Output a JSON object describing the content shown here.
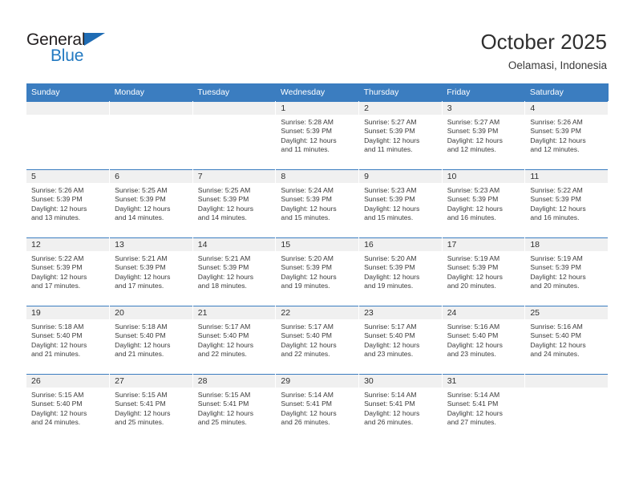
{
  "brand": {
    "name_part1": "General",
    "name_part2": "Blue",
    "triangle_color": "#1f6cb4",
    "blue_text_color": "#2279c1"
  },
  "header": {
    "month_title": "October 2025",
    "location": "Oelamasi, Indonesia"
  },
  "theme": {
    "header_blue": "#3b7dc0",
    "daynum_band": "#f0f0f0",
    "cell_bg": "#ffffff"
  },
  "calendar": {
    "weekday_headers": [
      "Sunday",
      "Monday",
      "Tuesday",
      "Wednesday",
      "Thursday",
      "Friday",
      "Saturday"
    ],
    "weeks": [
      [
        {
          "day": "",
          "lines": []
        },
        {
          "day": "",
          "lines": []
        },
        {
          "day": "",
          "lines": []
        },
        {
          "day": "1",
          "lines": [
            "Sunrise: 5:28 AM",
            "Sunset: 5:39 PM",
            "Daylight: 12 hours",
            "and 11 minutes."
          ]
        },
        {
          "day": "2",
          "lines": [
            "Sunrise: 5:27 AM",
            "Sunset: 5:39 PM",
            "Daylight: 12 hours",
            "and 11 minutes."
          ]
        },
        {
          "day": "3",
          "lines": [
            "Sunrise: 5:27 AM",
            "Sunset: 5:39 PM",
            "Daylight: 12 hours",
            "and 12 minutes."
          ]
        },
        {
          "day": "4",
          "lines": [
            "Sunrise: 5:26 AM",
            "Sunset: 5:39 PM",
            "Daylight: 12 hours",
            "and 12 minutes."
          ]
        }
      ],
      [
        {
          "day": "5",
          "lines": [
            "Sunrise: 5:26 AM",
            "Sunset: 5:39 PM",
            "Daylight: 12 hours",
            "and 13 minutes."
          ]
        },
        {
          "day": "6",
          "lines": [
            "Sunrise: 5:25 AM",
            "Sunset: 5:39 PM",
            "Daylight: 12 hours",
            "and 14 minutes."
          ]
        },
        {
          "day": "7",
          "lines": [
            "Sunrise: 5:25 AM",
            "Sunset: 5:39 PM",
            "Daylight: 12 hours",
            "and 14 minutes."
          ]
        },
        {
          "day": "8",
          "lines": [
            "Sunrise: 5:24 AM",
            "Sunset: 5:39 PM",
            "Daylight: 12 hours",
            "and 15 minutes."
          ]
        },
        {
          "day": "9",
          "lines": [
            "Sunrise: 5:23 AM",
            "Sunset: 5:39 PM",
            "Daylight: 12 hours",
            "and 15 minutes."
          ]
        },
        {
          "day": "10",
          "lines": [
            "Sunrise: 5:23 AM",
            "Sunset: 5:39 PM",
            "Daylight: 12 hours",
            "and 16 minutes."
          ]
        },
        {
          "day": "11",
          "lines": [
            "Sunrise: 5:22 AM",
            "Sunset: 5:39 PM",
            "Daylight: 12 hours",
            "and 16 minutes."
          ]
        }
      ],
      [
        {
          "day": "12",
          "lines": [
            "Sunrise: 5:22 AM",
            "Sunset: 5:39 PM",
            "Daylight: 12 hours",
            "and 17 minutes."
          ]
        },
        {
          "day": "13",
          "lines": [
            "Sunrise: 5:21 AM",
            "Sunset: 5:39 PM",
            "Daylight: 12 hours",
            "and 17 minutes."
          ]
        },
        {
          "day": "14",
          "lines": [
            "Sunrise: 5:21 AM",
            "Sunset: 5:39 PM",
            "Daylight: 12 hours",
            "and 18 minutes."
          ]
        },
        {
          "day": "15",
          "lines": [
            "Sunrise: 5:20 AM",
            "Sunset: 5:39 PM",
            "Daylight: 12 hours",
            "and 19 minutes."
          ]
        },
        {
          "day": "16",
          "lines": [
            "Sunrise: 5:20 AM",
            "Sunset: 5:39 PM",
            "Daylight: 12 hours",
            "and 19 minutes."
          ]
        },
        {
          "day": "17",
          "lines": [
            "Sunrise: 5:19 AM",
            "Sunset: 5:39 PM",
            "Daylight: 12 hours",
            "and 20 minutes."
          ]
        },
        {
          "day": "18",
          "lines": [
            "Sunrise: 5:19 AM",
            "Sunset: 5:39 PM",
            "Daylight: 12 hours",
            "and 20 minutes."
          ]
        }
      ],
      [
        {
          "day": "19",
          "lines": [
            "Sunrise: 5:18 AM",
            "Sunset: 5:40 PM",
            "Daylight: 12 hours",
            "and 21 minutes."
          ]
        },
        {
          "day": "20",
          "lines": [
            "Sunrise: 5:18 AM",
            "Sunset: 5:40 PM",
            "Daylight: 12 hours",
            "and 21 minutes."
          ]
        },
        {
          "day": "21",
          "lines": [
            "Sunrise: 5:17 AM",
            "Sunset: 5:40 PM",
            "Daylight: 12 hours",
            "and 22 minutes."
          ]
        },
        {
          "day": "22",
          "lines": [
            "Sunrise: 5:17 AM",
            "Sunset: 5:40 PM",
            "Daylight: 12 hours",
            "and 22 minutes."
          ]
        },
        {
          "day": "23",
          "lines": [
            "Sunrise: 5:17 AM",
            "Sunset: 5:40 PM",
            "Daylight: 12 hours",
            "and 23 minutes."
          ]
        },
        {
          "day": "24",
          "lines": [
            "Sunrise: 5:16 AM",
            "Sunset: 5:40 PM",
            "Daylight: 12 hours",
            "and 23 minutes."
          ]
        },
        {
          "day": "25",
          "lines": [
            "Sunrise: 5:16 AM",
            "Sunset: 5:40 PM",
            "Daylight: 12 hours",
            "and 24 minutes."
          ]
        }
      ],
      [
        {
          "day": "26",
          "lines": [
            "Sunrise: 5:15 AM",
            "Sunset: 5:40 PM",
            "Daylight: 12 hours",
            "and 24 minutes."
          ]
        },
        {
          "day": "27",
          "lines": [
            "Sunrise: 5:15 AM",
            "Sunset: 5:41 PM",
            "Daylight: 12 hours",
            "and 25 minutes."
          ]
        },
        {
          "day": "28",
          "lines": [
            "Sunrise: 5:15 AM",
            "Sunset: 5:41 PM",
            "Daylight: 12 hours",
            "and 25 minutes."
          ]
        },
        {
          "day": "29",
          "lines": [
            "Sunrise: 5:14 AM",
            "Sunset: 5:41 PM",
            "Daylight: 12 hours",
            "and 26 minutes."
          ]
        },
        {
          "day": "30",
          "lines": [
            "Sunrise: 5:14 AM",
            "Sunset: 5:41 PM",
            "Daylight: 12 hours",
            "and 26 minutes."
          ]
        },
        {
          "day": "31",
          "lines": [
            "Sunrise: 5:14 AM",
            "Sunset: 5:41 PM",
            "Daylight: 12 hours",
            "and 27 minutes."
          ]
        },
        {
          "day": "",
          "lines": []
        }
      ]
    ]
  }
}
